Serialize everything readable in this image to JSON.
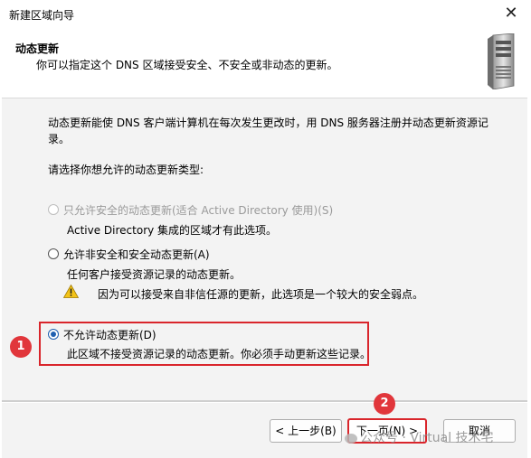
{
  "window": {
    "title": "新建区域向导",
    "close_glyph": "✕"
  },
  "header": {
    "title": "动态更新",
    "subtitle": "你可以指定这个 DNS 区域接受安全、不安全或非动态的更新。",
    "icon": "server-icon"
  },
  "body": {
    "intro_line1": "动态更新能使 DNS 客户端计算机在每次发生更改时，用 DNS 服务器注册并动态更新资源记",
    "intro_line2": "录。",
    "prompt": "请选择你想允许的动态更新类型:",
    "options": [
      {
        "label": "只允许安全的动态更新(适合 Active Directory 使用)(S)",
        "description": "Active Directory 集成的区域才有此选项。",
        "selected": false,
        "enabled": false
      },
      {
        "label": "允许非安全和安全动态更新(A)",
        "description": "任何客户接受资源记录的动态更新。",
        "selected": false,
        "enabled": true
      },
      {
        "label": "不允许动态更新(D)",
        "description": "此区域不接受资源记录的动态更新。你必须手动更新这些记录。",
        "selected": true,
        "enabled": true
      }
    ],
    "warning": "因为可以接受来自非信任源的更新，此选项是一个较大的安全弱点。"
  },
  "annotations": {
    "badge1": "1",
    "badge2": "2",
    "color": "#d9252b"
  },
  "buttons": {
    "back": "< 上一步(B)",
    "next": "下一页(N) >",
    "cancel": "取消"
  },
  "watermark": "公众号 · Virtual 技术宅",
  "colors": {
    "accent": "#1f5fb0",
    "highlight": "#d9252b",
    "body_bg": "#f3f3f3"
  }
}
